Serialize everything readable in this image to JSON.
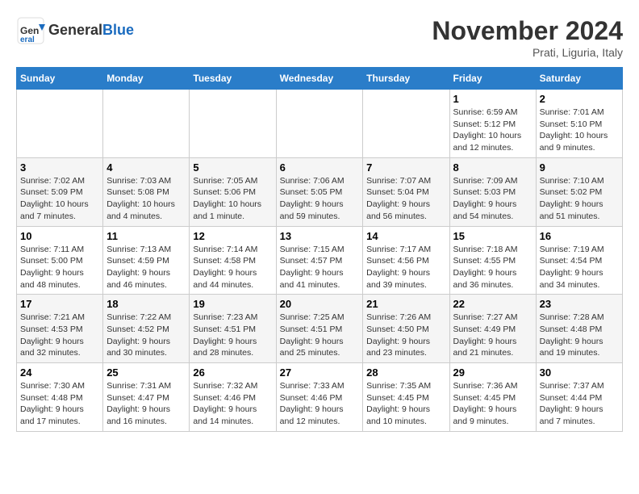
{
  "header": {
    "logo_general": "General",
    "logo_blue": "Blue",
    "month_title": "November 2024",
    "subtitle": "Prati, Liguria, Italy"
  },
  "weekdays": [
    "Sunday",
    "Monday",
    "Tuesday",
    "Wednesday",
    "Thursday",
    "Friday",
    "Saturday"
  ],
  "weeks": [
    [
      {
        "day": "",
        "info": ""
      },
      {
        "day": "",
        "info": ""
      },
      {
        "day": "",
        "info": ""
      },
      {
        "day": "",
        "info": ""
      },
      {
        "day": "",
        "info": ""
      },
      {
        "day": "1",
        "info": "Sunrise: 6:59 AM\nSunset: 5:12 PM\nDaylight: 10 hours and 12 minutes."
      },
      {
        "day": "2",
        "info": "Sunrise: 7:01 AM\nSunset: 5:10 PM\nDaylight: 10 hours and 9 minutes."
      }
    ],
    [
      {
        "day": "3",
        "info": "Sunrise: 7:02 AM\nSunset: 5:09 PM\nDaylight: 10 hours and 7 minutes."
      },
      {
        "day": "4",
        "info": "Sunrise: 7:03 AM\nSunset: 5:08 PM\nDaylight: 10 hours and 4 minutes."
      },
      {
        "day": "5",
        "info": "Sunrise: 7:05 AM\nSunset: 5:06 PM\nDaylight: 10 hours and 1 minute."
      },
      {
        "day": "6",
        "info": "Sunrise: 7:06 AM\nSunset: 5:05 PM\nDaylight: 9 hours and 59 minutes."
      },
      {
        "day": "7",
        "info": "Sunrise: 7:07 AM\nSunset: 5:04 PM\nDaylight: 9 hours and 56 minutes."
      },
      {
        "day": "8",
        "info": "Sunrise: 7:09 AM\nSunset: 5:03 PM\nDaylight: 9 hours and 54 minutes."
      },
      {
        "day": "9",
        "info": "Sunrise: 7:10 AM\nSunset: 5:02 PM\nDaylight: 9 hours and 51 minutes."
      }
    ],
    [
      {
        "day": "10",
        "info": "Sunrise: 7:11 AM\nSunset: 5:00 PM\nDaylight: 9 hours and 48 minutes."
      },
      {
        "day": "11",
        "info": "Sunrise: 7:13 AM\nSunset: 4:59 PM\nDaylight: 9 hours and 46 minutes."
      },
      {
        "day": "12",
        "info": "Sunrise: 7:14 AM\nSunset: 4:58 PM\nDaylight: 9 hours and 44 minutes."
      },
      {
        "day": "13",
        "info": "Sunrise: 7:15 AM\nSunset: 4:57 PM\nDaylight: 9 hours and 41 minutes."
      },
      {
        "day": "14",
        "info": "Sunrise: 7:17 AM\nSunset: 4:56 PM\nDaylight: 9 hours and 39 minutes."
      },
      {
        "day": "15",
        "info": "Sunrise: 7:18 AM\nSunset: 4:55 PM\nDaylight: 9 hours and 36 minutes."
      },
      {
        "day": "16",
        "info": "Sunrise: 7:19 AM\nSunset: 4:54 PM\nDaylight: 9 hours and 34 minutes."
      }
    ],
    [
      {
        "day": "17",
        "info": "Sunrise: 7:21 AM\nSunset: 4:53 PM\nDaylight: 9 hours and 32 minutes."
      },
      {
        "day": "18",
        "info": "Sunrise: 7:22 AM\nSunset: 4:52 PM\nDaylight: 9 hours and 30 minutes."
      },
      {
        "day": "19",
        "info": "Sunrise: 7:23 AM\nSunset: 4:51 PM\nDaylight: 9 hours and 28 minutes."
      },
      {
        "day": "20",
        "info": "Sunrise: 7:25 AM\nSunset: 4:51 PM\nDaylight: 9 hours and 25 minutes."
      },
      {
        "day": "21",
        "info": "Sunrise: 7:26 AM\nSunset: 4:50 PM\nDaylight: 9 hours and 23 minutes."
      },
      {
        "day": "22",
        "info": "Sunrise: 7:27 AM\nSunset: 4:49 PM\nDaylight: 9 hours and 21 minutes."
      },
      {
        "day": "23",
        "info": "Sunrise: 7:28 AM\nSunset: 4:48 PM\nDaylight: 9 hours and 19 minutes."
      }
    ],
    [
      {
        "day": "24",
        "info": "Sunrise: 7:30 AM\nSunset: 4:48 PM\nDaylight: 9 hours and 17 minutes."
      },
      {
        "day": "25",
        "info": "Sunrise: 7:31 AM\nSunset: 4:47 PM\nDaylight: 9 hours and 16 minutes."
      },
      {
        "day": "26",
        "info": "Sunrise: 7:32 AM\nSunset: 4:46 PM\nDaylight: 9 hours and 14 minutes."
      },
      {
        "day": "27",
        "info": "Sunrise: 7:33 AM\nSunset: 4:46 PM\nDaylight: 9 hours and 12 minutes."
      },
      {
        "day": "28",
        "info": "Sunrise: 7:35 AM\nSunset: 4:45 PM\nDaylight: 9 hours and 10 minutes."
      },
      {
        "day": "29",
        "info": "Sunrise: 7:36 AM\nSunset: 4:45 PM\nDaylight: 9 hours and 9 minutes."
      },
      {
        "day": "30",
        "info": "Sunrise: 7:37 AM\nSunset: 4:44 PM\nDaylight: 9 hours and 7 minutes."
      }
    ]
  ]
}
